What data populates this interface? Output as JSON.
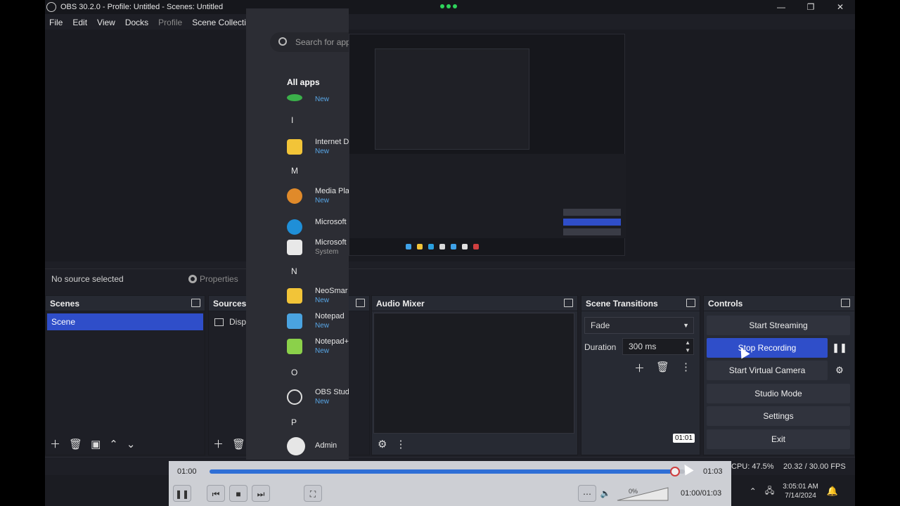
{
  "window": {
    "title": "OBS 30.2.0 - Profile: Untitled - Scenes: Untitled",
    "controls": [
      "—",
      "❐",
      "✕"
    ]
  },
  "menu": [
    "File",
    "Edit",
    "View",
    "Docks",
    "Profile",
    "Scene Collection"
  ],
  "source_bar": {
    "no_source": "No source selected",
    "properties": "Properties"
  },
  "docks": {
    "scenes": {
      "title": "Scenes",
      "items": [
        "Scene"
      ]
    },
    "sources": {
      "title": "Sources",
      "items": [
        "Displ"
      ]
    },
    "audio_mixer": {
      "title": "Audio Mixer"
    },
    "scene_transitions": {
      "title": "Scene Transitions",
      "transition": "Fade",
      "duration_label": "Duration",
      "duration_value": "300 ms"
    },
    "controls": {
      "title": "Controls",
      "buttons": [
        "Start Streaming",
        "Stop Recording",
        "Start Virtual Camera",
        "Studio Mode",
        "Settings",
        "Exit"
      ]
    }
  },
  "start_menu": {
    "search_placeholder": "Search for apps",
    "all_apps": "All apps",
    "letters": [
      "I",
      "M",
      "N",
      "O",
      "P"
    ],
    "apps": [
      {
        "name": "",
        "sub": "New"
      },
      {
        "name": "Internet D",
        "sub": "New"
      },
      {
        "name": "Media Pla",
        "sub": "New"
      },
      {
        "name": "Microsoft",
        "sub": ""
      },
      {
        "name": "Microsoft",
        "sub": "System"
      },
      {
        "name": "NeoSmar",
        "sub": "New"
      },
      {
        "name": "Notepad",
        "sub": "New"
      },
      {
        "name": "Notepad+",
        "sub": "New"
      },
      {
        "name": "OBS Studi",
        "sub": "New"
      },
      {
        "name": "Admin",
        "sub": ""
      }
    ]
  },
  "status": {
    "cpu": "CPU: 47.5%",
    "fps": "20.32 / 30.00 FPS"
  },
  "clock": {
    "time": "3:05:01 AM",
    "date": "7/14/2024"
  },
  "player": {
    "time_start": "01:00",
    "time_end": "01:03",
    "position_label": "01:00/01:03",
    "tooltip": "01:01",
    "progress": 0.98,
    "volume_label": "0%"
  },
  "colors": {
    "accent": "#2f4ec9",
    "panel": "#272a33",
    "background": "#1e1f26"
  }
}
